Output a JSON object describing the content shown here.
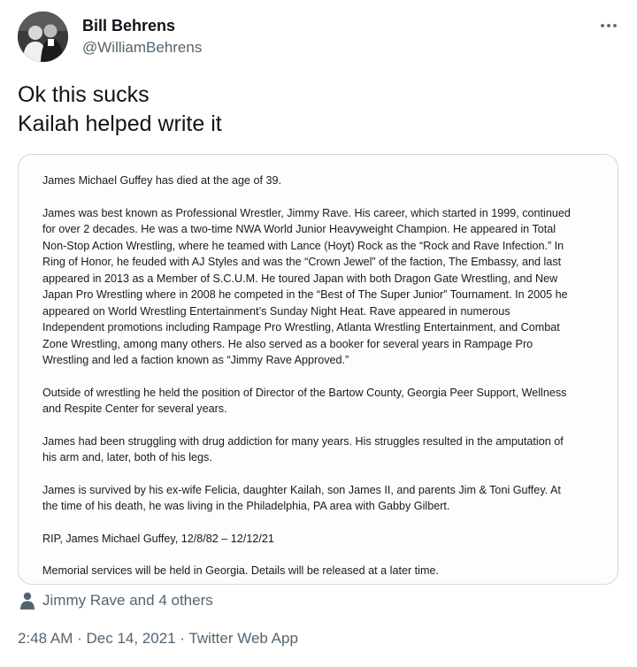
{
  "author": {
    "display_name": "Bill Behrens",
    "handle": "@WilliamBehrens",
    "avatar_icon": "profile-photo"
  },
  "more_icon": "more-horizontal-icon",
  "tweet": {
    "lines": [
      "Ok this sucks",
      "Kailah helped write it"
    ]
  },
  "document": {
    "paragraphs": [
      "James Michael Guffey has died at the age of 39.",
      "James was best known as Professional Wrestler, Jimmy Rave.  His career, which started in 1999, continued\nfor over 2 decades.  He was a two-time NWA World Junior Heavyweight Champion.  He appeared in Total\nNon-Stop Action Wrestling, where he teamed with Lance (Hoyt) Rock as the “Rock and Rave Infection.”  In\nRing of Honor, he feuded with AJ Styles and was the “Crown Jewel” of the faction, The Embassy, and last\nappeared in 2013 as a Member of S.C.U.M.  He toured Japan with both Dragon Gate Wrestling, and New\nJapan Pro Wrestling where in 2008 he competed in the “Best of The Super Junior” Tournament.  In 2005 he\nappeared on World Wrestling Entertainment’s Sunday Night Heat.  Rave appeared in numerous\nIndependent promotions including Rampage Pro Wrestling, Atlanta Wrestling Entertainment, and Combat\nZone Wrestling, among many others.  He also served as a booker for several years in Rampage Pro\nWrestling and led a faction known as “Jimmy Rave Approved.”",
      "Outside of wrestling he held the position of Director of the Bartow County, Georgia Peer Support, Wellness\nand Respite Center for several years.",
      "James had been struggling with drug addiction for many years. His struggles resulted in the amputation of\nhis arm and, later, both of his legs.",
      "James is survived by his ex-wife Felicia, daughter Kailah, son James II, and parents Jim & Toni Guffey.  At\nthe time of his death, he was living in the Philadelphia, PA area with Gabby Gilbert.",
      "RIP, James Michael Guffey, 12/8/82 – 12/12/21",
      "Memorial services will be held in Georgia. Details will be released at a later time."
    ]
  },
  "liked_by": {
    "icon": "person-icon",
    "text": "Jimmy Rave and 4 others"
  },
  "meta": {
    "time": "2:48 AM",
    "sep1": " · ",
    "date": "Dec 14, 2021",
    "sep2": " · ",
    "source": "Twitter Web App"
  },
  "colors": {
    "text_primary": "#0f1419",
    "text_secondary": "#536471",
    "border": "#cfd9de"
  }
}
